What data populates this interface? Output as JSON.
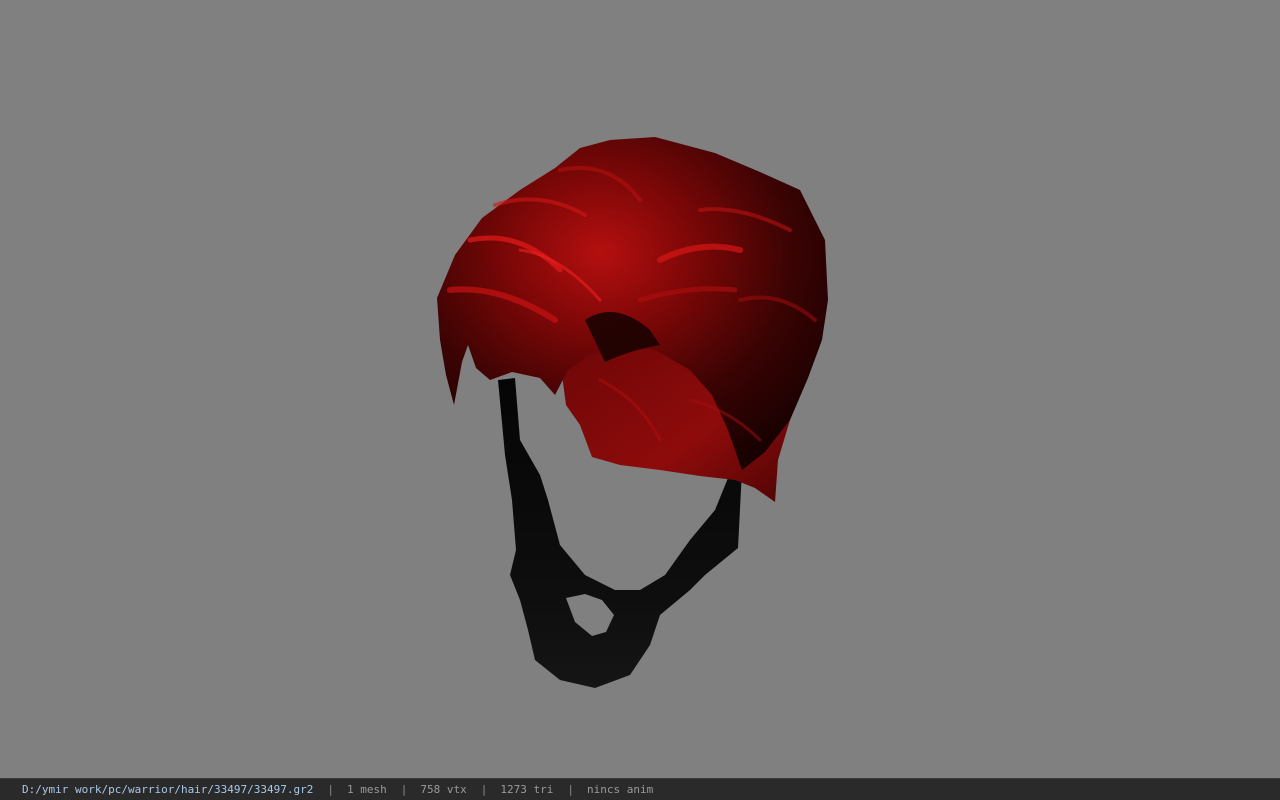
{
  "viewport": {
    "background_color": "#808080",
    "model": {
      "hair_color": "#9a0a0a",
      "shadow_color": "#0a0a0a"
    }
  },
  "status_bar": {
    "file_path": "D:/ymir work/pc/warrior/hair/33497/33497.gr2",
    "separator": "|",
    "mesh_count": "1 mesh",
    "vertex_count": "758 vtx",
    "triangle_count": "1273 tri",
    "anim_status": "nincs anim"
  }
}
